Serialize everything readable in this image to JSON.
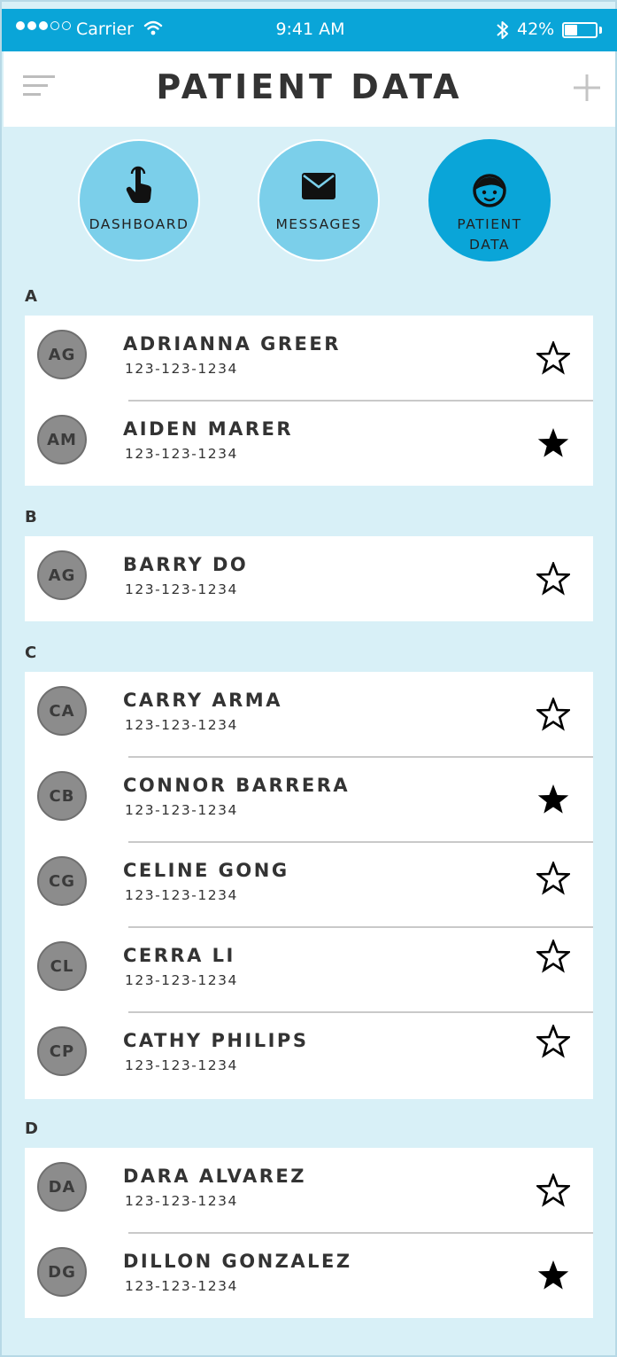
{
  "status_bar": {
    "carrier": "Carrier",
    "time": "9:41 AM",
    "battery": "42%",
    "battery_level": 0.42
  },
  "header": {
    "title": "PATIENT DATA",
    "menu_icon": "menu-icon",
    "add_icon": "plus-icon"
  },
  "nav": [
    {
      "label": "DASHBOARD",
      "icon": "touch-icon",
      "active": false
    },
    {
      "label": "MESSAGES",
      "icon": "envelope-icon",
      "active": false
    },
    {
      "label": "PATIENT DATA",
      "icon": "face-icon",
      "active": true
    }
  ],
  "colors": {
    "accent": "#0aa5d8",
    "accent_light": "#7bcfea",
    "background": "#d8f0f7",
    "avatar": "#8c8c8c"
  },
  "sections": [
    {
      "letter": "A",
      "patients": [
        {
          "initials": "AG",
          "name": "ADRIANNA GREER",
          "phone": "123-123-1234",
          "starred": false
        },
        {
          "initials": "AM",
          "name": "AIDEN MARER",
          "phone": "123-123-1234",
          "starred": true
        }
      ]
    },
    {
      "letter": "B",
      "patients": [
        {
          "initials": "AG",
          "name": "BARRY DO",
          "phone": "123-123-1234",
          "starred": false
        }
      ]
    },
    {
      "letter": "C",
      "patients": [
        {
          "initials": "CA",
          "name": "CARRY ARMA",
          "phone": "123-123-1234",
          "starred": false
        },
        {
          "initials": "CB",
          "name": "CONNOR BARRERA",
          "phone": "123-123-1234",
          "starred": true
        },
        {
          "initials": "CG",
          "name": "CELINE GONG",
          "phone": "123-123-1234",
          "starred": false
        },
        {
          "initials": "CL",
          "name": "CERRA LI",
          "phone": "123-123-1234",
          "starred": false
        },
        {
          "initials": "CP",
          "name": "CATHY PHILIPS",
          "phone": "123-123-1234",
          "starred": false
        }
      ]
    },
    {
      "letter": "D",
      "patients": [
        {
          "initials": "DA",
          "name": "DARA ALVAREZ",
          "phone": "123-123-1234",
          "starred": false
        },
        {
          "initials": "DG",
          "name": "DILLON GONZALEZ",
          "phone": "123-123-1234",
          "starred": true
        }
      ]
    }
  ]
}
